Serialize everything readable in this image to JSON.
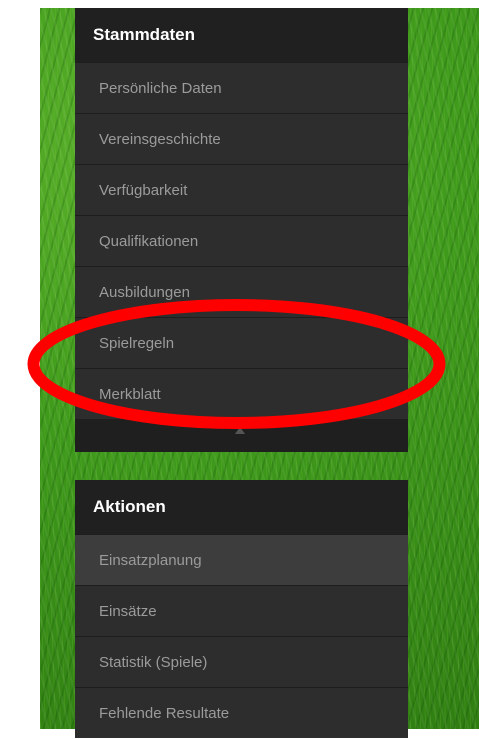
{
  "stammdaten": {
    "title": "Stammdaten",
    "items": [
      {
        "label": "Persönliche Daten"
      },
      {
        "label": "Vereinsgeschichte"
      },
      {
        "label": "Verfügbarkeit"
      },
      {
        "label": "Qualifikationen"
      },
      {
        "label": "Ausbildungen"
      },
      {
        "label": "Spielregeln"
      },
      {
        "label": "Merkblatt"
      }
    ]
  },
  "aktionen": {
    "title": "Aktionen",
    "items": [
      {
        "label": "Einsatzplanung"
      },
      {
        "label": "Einsätze"
      },
      {
        "label": "Statistik (Spiele)"
      },
      {
        "label": "Fehlende Resultate"
      }
    ]
  },
  "colors": {
    "annotation": "#ff0000",
    "panel": "#2c2c2c",
    "header": "#202020",
    "grass": "#3f9a1c"
  }
}
